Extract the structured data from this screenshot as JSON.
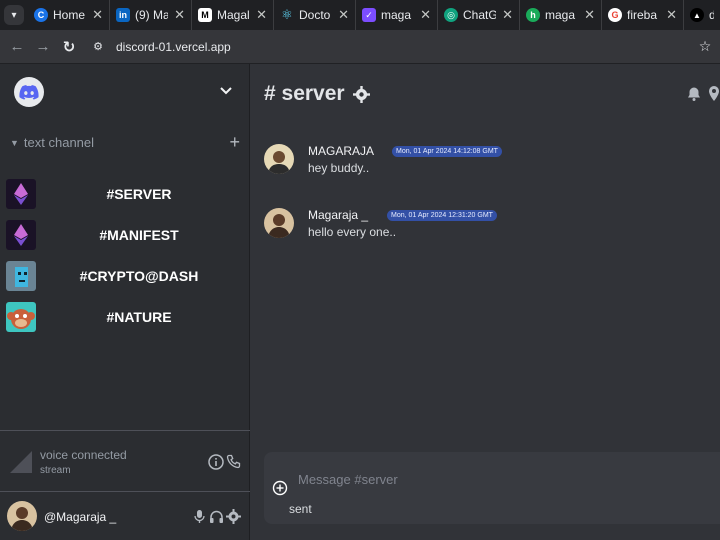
{
  "browser": {
    "tabs": [
      {
        "title": "Home",
        "icon": "c-circle-icon",
        "color": "#1a73e8",
        "letter": "C"
      },
      {
        "title": "(9) Ma",
        "icon": "linkedin-icon",
        "color": "#0a66c2",
        "letter": "in"
      },
      {
        "title": "Magal",
        "icon": "medium-icon",
        "color": "#ffffff",
        "letter": "M"
      },
      {
        "title": "Docto",
        "icon": "react-icon",
        "color": "#61dafb",
        "letter": "⚛"
      },
      {
        "title": "maga",
        "icon": "check-square-icon",
        "color": "#7c4dff",
        "letter": "✓"
      },
      {
        "title": "ChatG",
        "icon": "openai-icon",
        "color": "#10a37f",
        "letter": "◎"
      },
      {
        "title": "maga",
        "icon": "green-h-icon",
        "color": "#1aab5a",
        "letter": "h"
      },
      {
        "title": "fireba",
        "icon": "google-icon",
        "color": "#ffffff",
        "letter": "G"
      },
      {
        "title": "d",
        "icon": "vercel-icon",
        "color": "#000000",
        "letter": "▲"
      }
    ],
    "url": "discord-01.vercel.app"
  },
  "sidebar": {
    "category": "text channel",
    "channels": [
      {
        "name": "#SERVER"
      },
      {
        "name": "#MANIFEST"
      },
      {
        "name": "#CRYPTO@DASH"
      },
      {
        "name": "#NATURE"
      }
    ],
    "voice": {
      "title": "voice connected",
      "subtitle": "stream"
    },
    "user": {
      "name": "@Magaraja _"
    }
  },
  "main": {
    "channel_title": "# server",
    "messages": [
      {
        "author": "MAGARAJA",
        "timestamp": "Mon, 01 Apr 2024 14:12:08 GMT",
        "text": "hey buddy.."
      },
      {
        "author": "Magaraja _",
        "timestamp": "Mon, 01 Apr 2024 12:31:20 GMT",
        "text": "hello every one.."
      }
    ],
    "composer": {
      "placeholder": "Message #server",
      "status": "sent"
    }
  },
  "colors": {
    "sidebar_bg": "#2b2d31",
    "main_bg": "#313338",
    "timestamp_badge": "#3350a6"
  }
}
